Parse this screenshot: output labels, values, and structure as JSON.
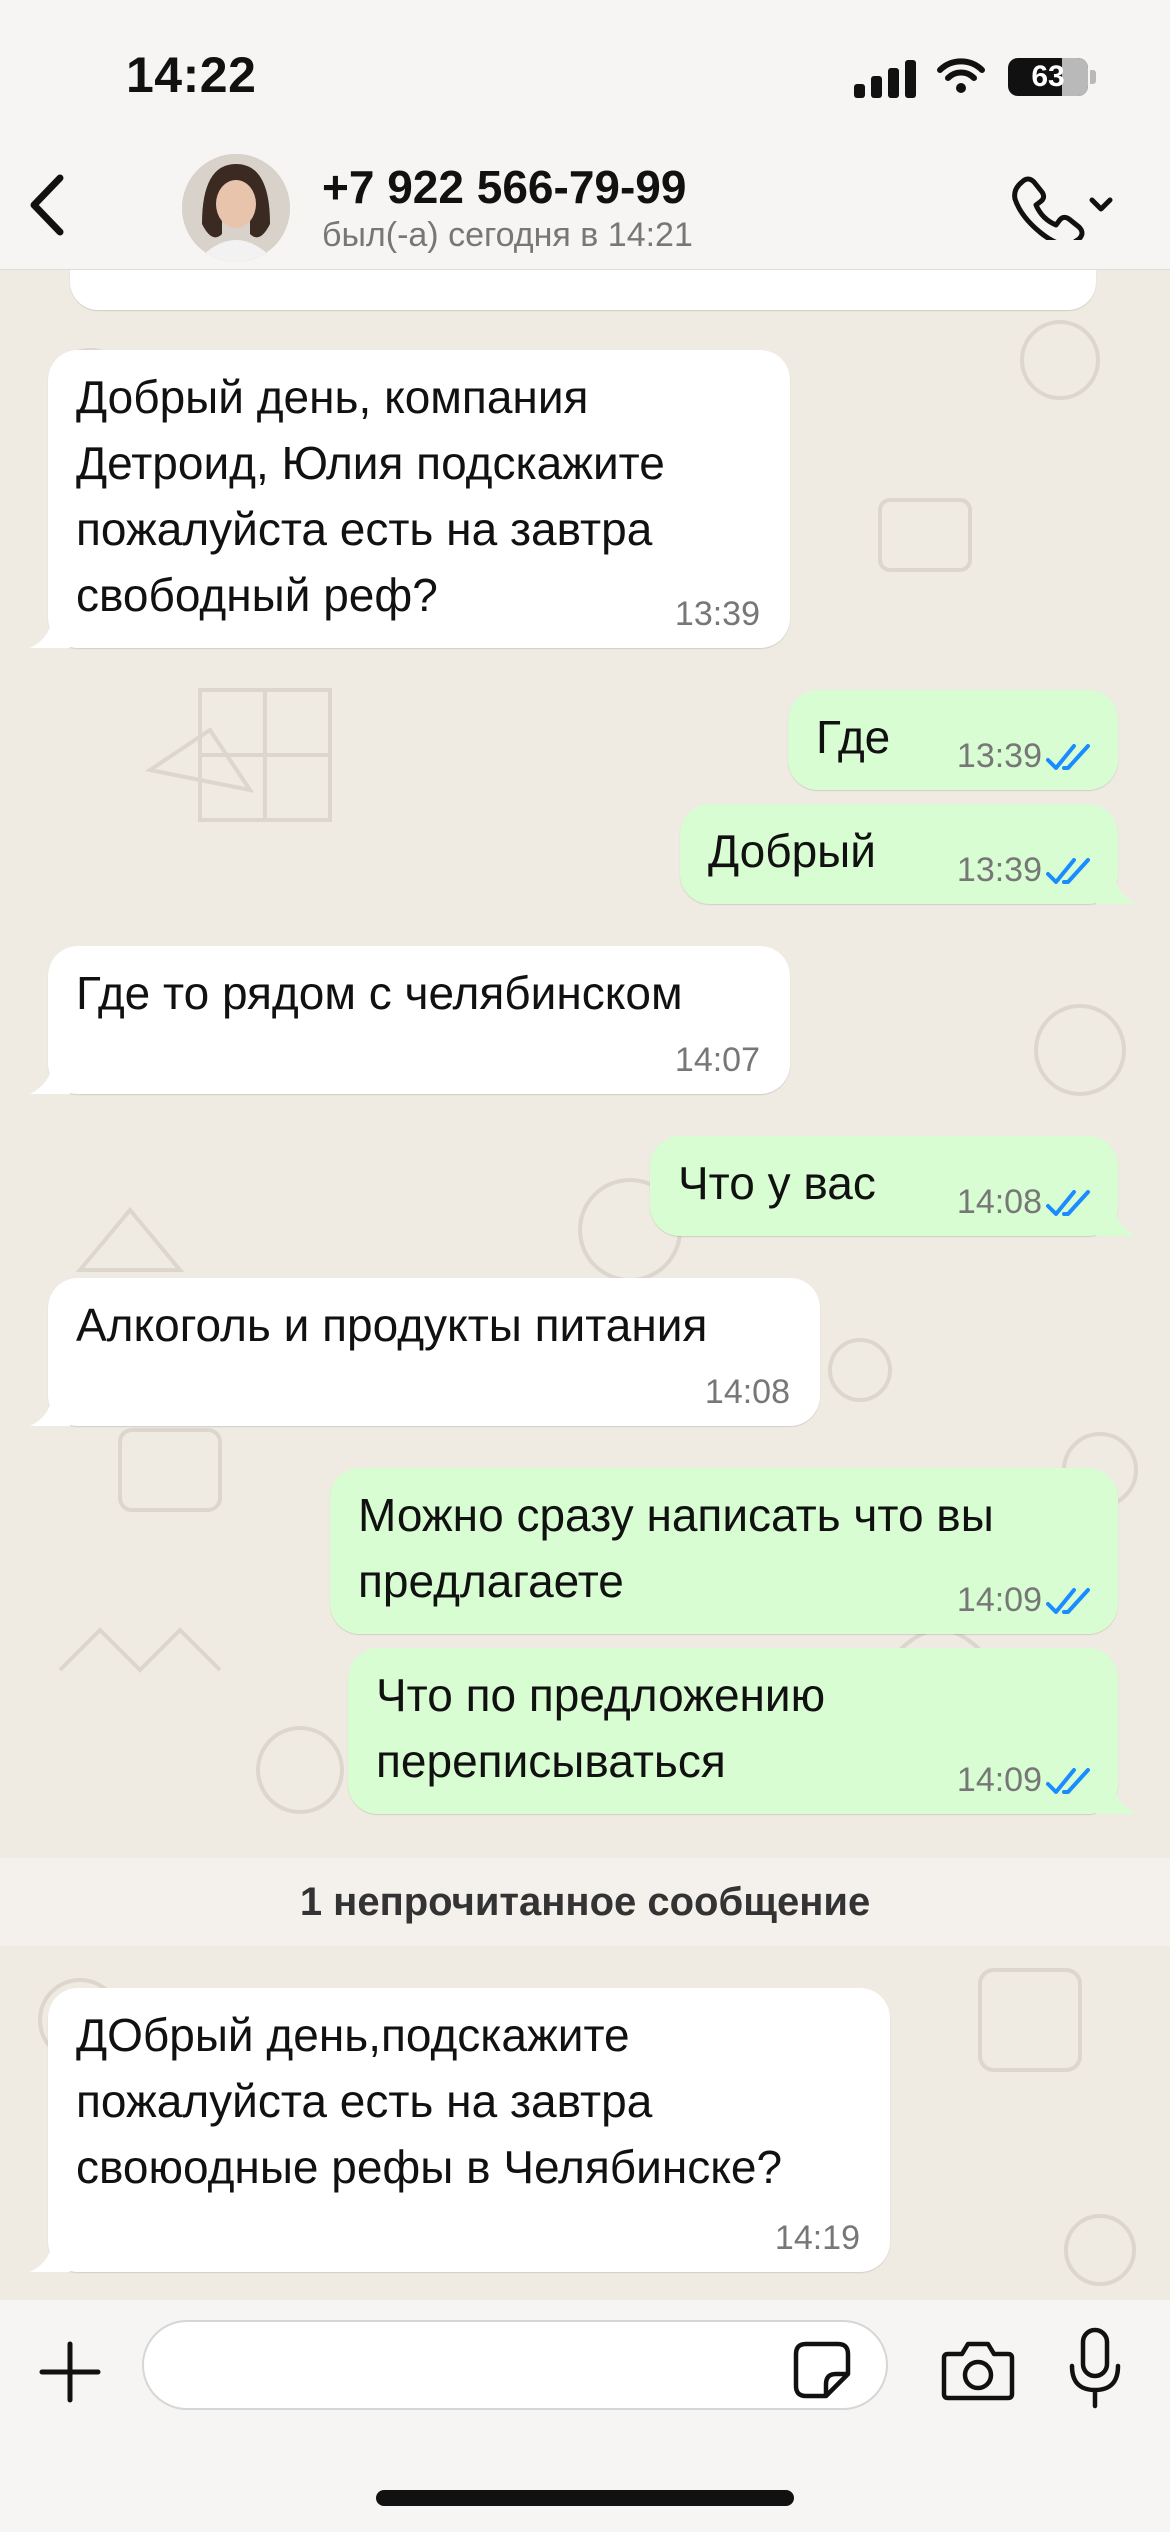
{
  "status_bar": {
    "time": "14:22",
    "battery": "63"
  },
  "header": {
    "back_icon": "chevron-left-icon",
    "contact_name": "+7 922 566-79-99",
    "contact_status": "был(-а) сегодня в 14:21",
    "call_icon": "phone-icon"
  },
  "messages": [
    {
      "direction": "in",
      "lines": [
        "Добрый день, компания",
        "Детроид, Юлия подскажите",
        "пожалуйста есть на завтра",
        "свободный реф?"
      ],
      "time": "13:39"
    },
    {
      "direction": "out",
      "lines": [
        "Где"
      ],
      "time": "13:39",
      "read": true
    },
    {
      "direction": "out",
      "lines": [
        "Добрый"
      ],
      "time": "13:39",
      "read": true
    },
    {
      "direction": "in",
      "lines": [
        "Где то рядом с челябинском"
      ],
      "time": "14:07"
    },
    {
      "direction": "out",
      "lines": [
        "Что у вас"
      ],
      "time": "14:08",
      "read": true
    },
    {
      "direction": "in",
      "lines": [
        "Алкоголь и продукты питания"
      ],
      "time": "14:08"
    },
    {
      "direction": "out",
      "lines": [
        "Можно сразу написать что вы",
        "предлагаете"
      ],
      "time": "14:09",
      "read": true
    },
    {
      "direction": "out",
      "lines": [
        "Что по предложению",
        "переписываться"
      ],
      "time": "14:09",
      "read": true
    },
    {
      "direction": "in",
      "lines": [
        "ДОбрый день,подскажите",
        "пожалуйста есть на завтра",
        "своюодные рефы в Челябинске?"
      ],
      "time": "14:19"
    }
  ],
  "unread_banner": "1 непрочитанное сообщение",
  "input_bar": {
    "placeholder": "",
    "icons": [
      "plus-icon",
      "sticker-icon",
      "camera-icon",
      "microphone-icon"
    ]
  },
  "colors": {
    "incoming_bubble": "#ffffff",
    "outgoing_bubble": "#d9fdd3",
    "read_ticks": "#1a8cff",
    "wallpaper": "#efeae2"
  }
}
